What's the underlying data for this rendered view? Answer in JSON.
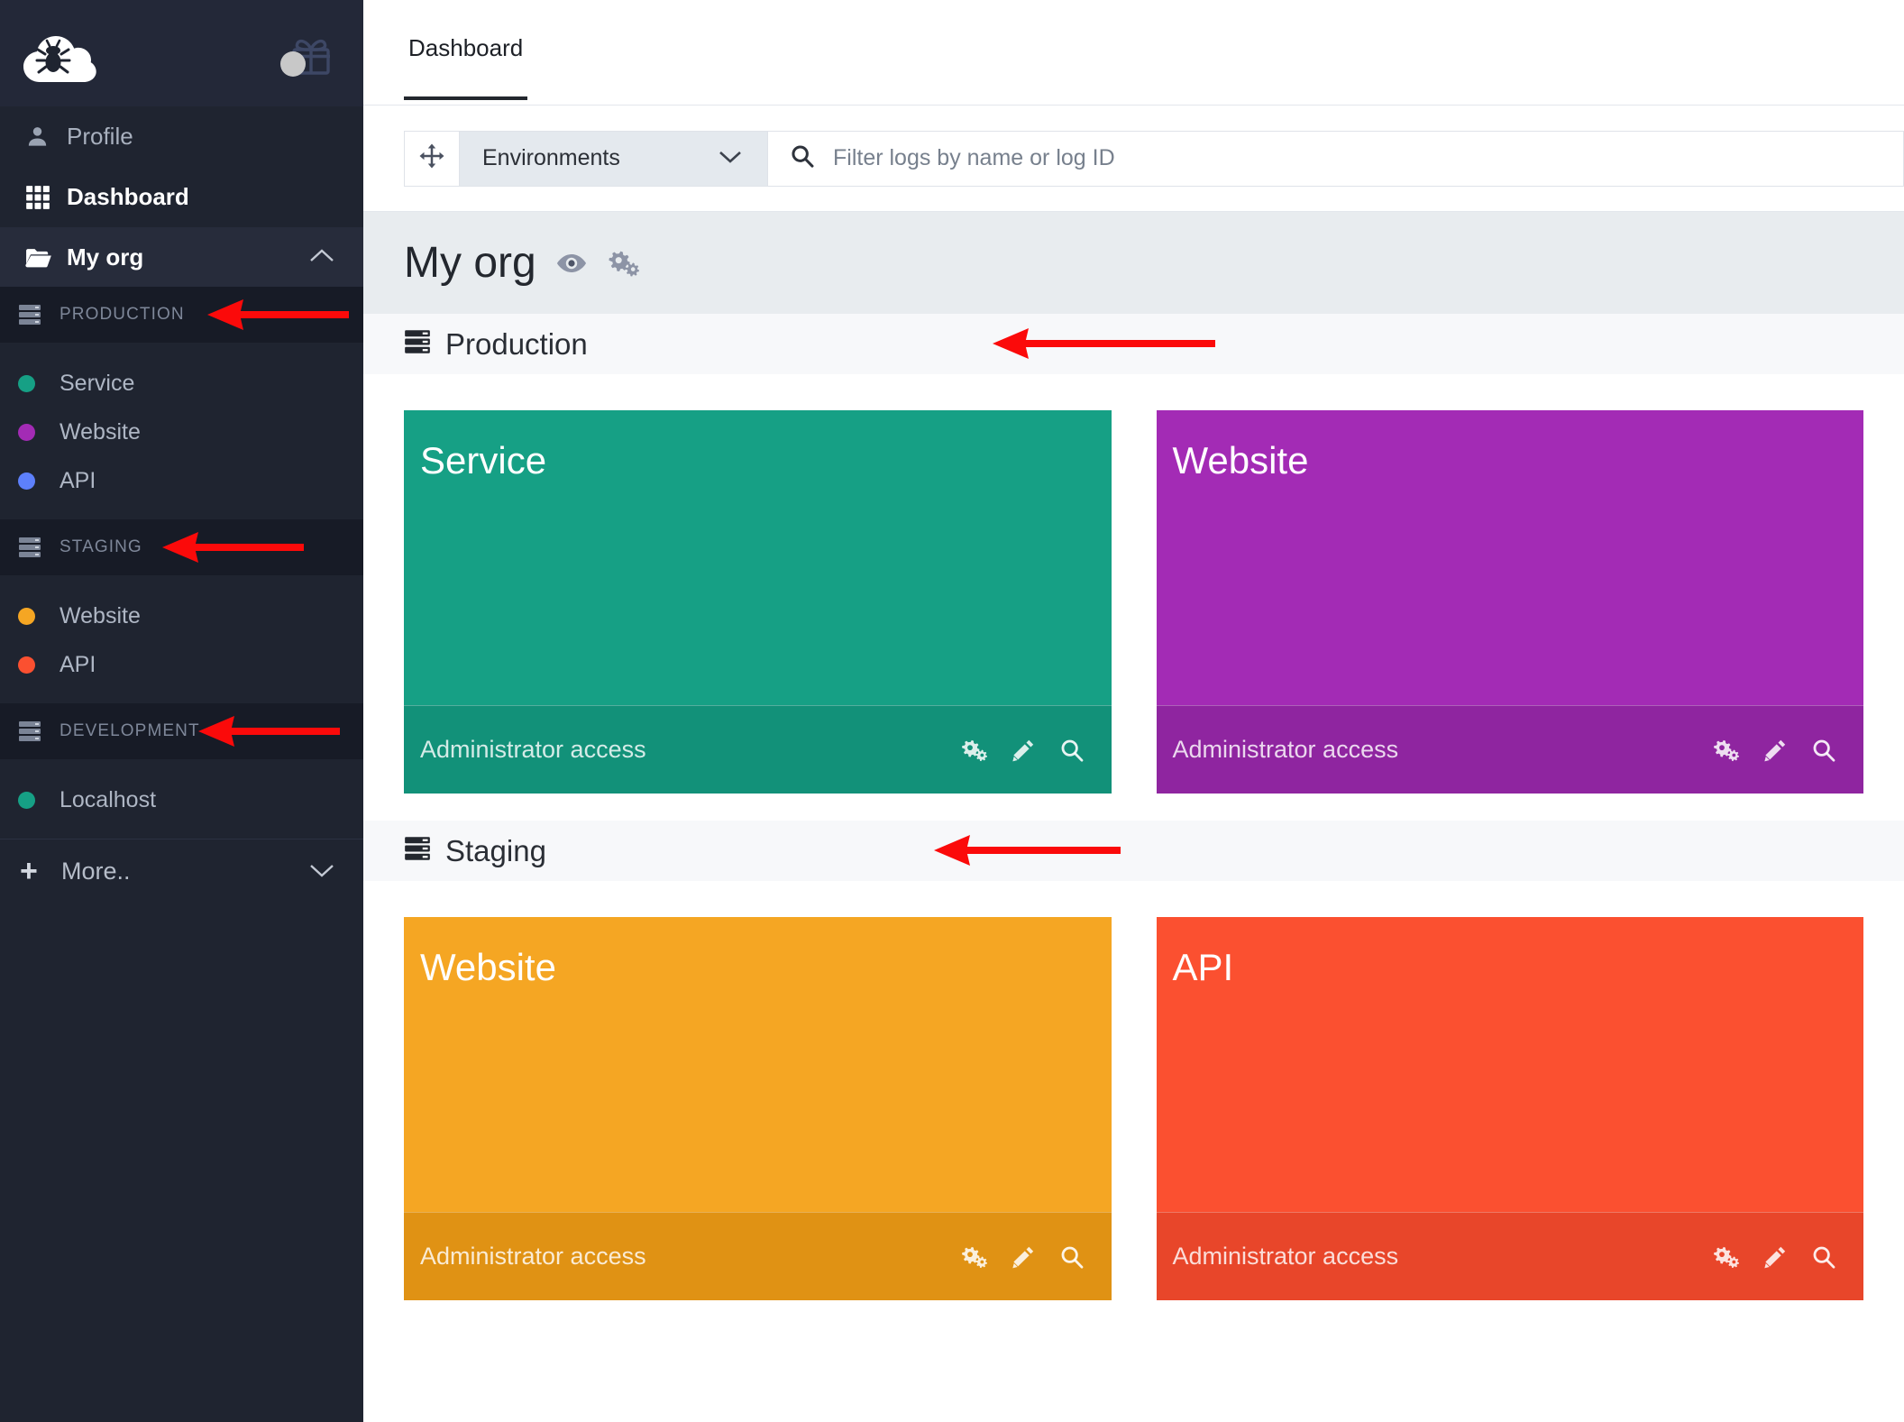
{
  "brand": {
    "logo_icon": "cloud-bug-logo",
    "gift_icon": "gift-icon"
  },
  "sidebar": {
    "items": [
      {
        "label": "Profile",
        "icon": "user-icon",
        "active": false
      },
      {
        "label": "Dashboard",
        "icon": "grid-icon",
        "active": true
      }
    ],
    "org": {
      "label": "My org",
      "icon": "folder-open-icon",
      "chevron": "chevron-up-icon"
    },
    "groups": [
      {
        "label": "PRODUCTION",
        "icon": "server-stack-icon",
        "items": [
          {
            "label": "Service",
            "color": "#16a085"
          },
          {
            "label": "Website",
            "color": "#a32bb5"
          },
          {
            "label": "API",
            "color": "#5d80fb"
          }
        ]
      },
      {
        "label": "STAGING",
        "icon": "server-stack-icon",
        "items": [
          {
            "label": "Website",
            "color": "#f5a623"
          },
          {
            "label": "API",
            "color": "#fb5030"
          }
        ]
      },
      {
        "label": "DEVELOPMENT",
        "icon": "server-stack-icon",
        "items": [
          {
            "label": "Localhost",
            "color": "#16a085"
          }
        ]
      }
    ],
    "more": {
      "label": "More..",
      "icon": "plus-icon",
      "chevron": "chevron-down-icon"
    }
  },
  "tabs": [
    {
      "label": "Dashboard",
      "active": true
    }
  ],
  "toolbar": {
    "drag_icon": "move-arrows-icon",
    "environments_label": "Environments",
    "environments_chevron": "chevron-down-icon",
    "search_icon": "search-icon",
    "search_value": "",
    "search_placeholder": "Filter logs by name or log ID"
  },
  "org_header": {
    "title": "My org",
    "eye_icon": "eye-icon",
    "cogs_icon": "cogs-icon"
  },
  "environments": [
    {
      "name": "Production",
      "icon": "server-stack-icon",
      "cards": [
        {
          "title": "Service",
          "access": "Administrator access",
          "color": "#16a085",
          "footer_color": "#129179",
          "actions": [
            "cogs-icon",
            "pencil-icon",
            "search-icon"
          ]
        },
        {
          "title": "Website",
          "access": "Administrator access",
          "color": "#a32bb5",
          "footer_color": "#8f25a0",
          "actions": [
            "cogs-icon",
            "pencil-icon",
            "search-icon"
          ]
        }
      ]
    },
    {
      "name": "Staging",
      "icon": "server-stack-icon",
      "cards": [
        {
          "title": "Website",
          "access": "Administrator access",
          "color": "#f5a623",
          "footer_color": "#e09214",
          "actions": [
            "cogs-icon",
            "pencil-icon",
            "search-icon"
          ]
        },
        {
          "title": "API",
          "access": "Administrator access",
          "color": "#fb5030",
          "footer_color": "#e8462a",
          "actions": [
            "cogs-icon",
            "pencil-icon",
            "search-icon"
          ]
        }
      ]
    }
  ],
  "annotations": {
    "arrow_color": "#fb0a0a",
    "targets": [
      "PRODUCTION",
      "STAGING",
      "DEVELOPMENT",
      "Production",
      "Staging"
    ]
  }
}
